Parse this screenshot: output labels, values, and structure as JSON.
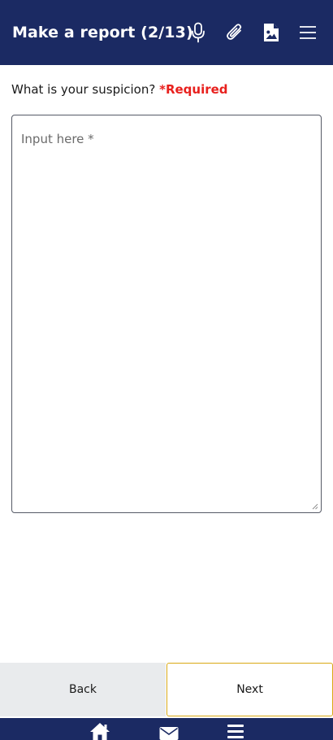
{
  "header": {
    "title": "Make a report (2/13)",
    "icons": [
      "microphone-icon",
      "paperclip-icon",
      "image-file-icon",
      "hamburger-menu-icon"
    ]
  },
  "form": {
    "question": "What is your suspicion?",
    "required_label": "*Required",
    "input_placeholder": "Input here *",
    "input_value": ""
  },
  "buttons": {
    "back_label": "Back",
    "next_label": "Next"
  },
  "bottom_nav": {
    "items": [
      "home-icon",
      "mail-icon",
      "menu-icon"
    ]
  },
  "colors": {
    "header_bg": "#1b2a63",
    "required": "#e8201d",
    "next_border": "#d9a915",
    "back_bg": "#e9ebed"
  }
}
